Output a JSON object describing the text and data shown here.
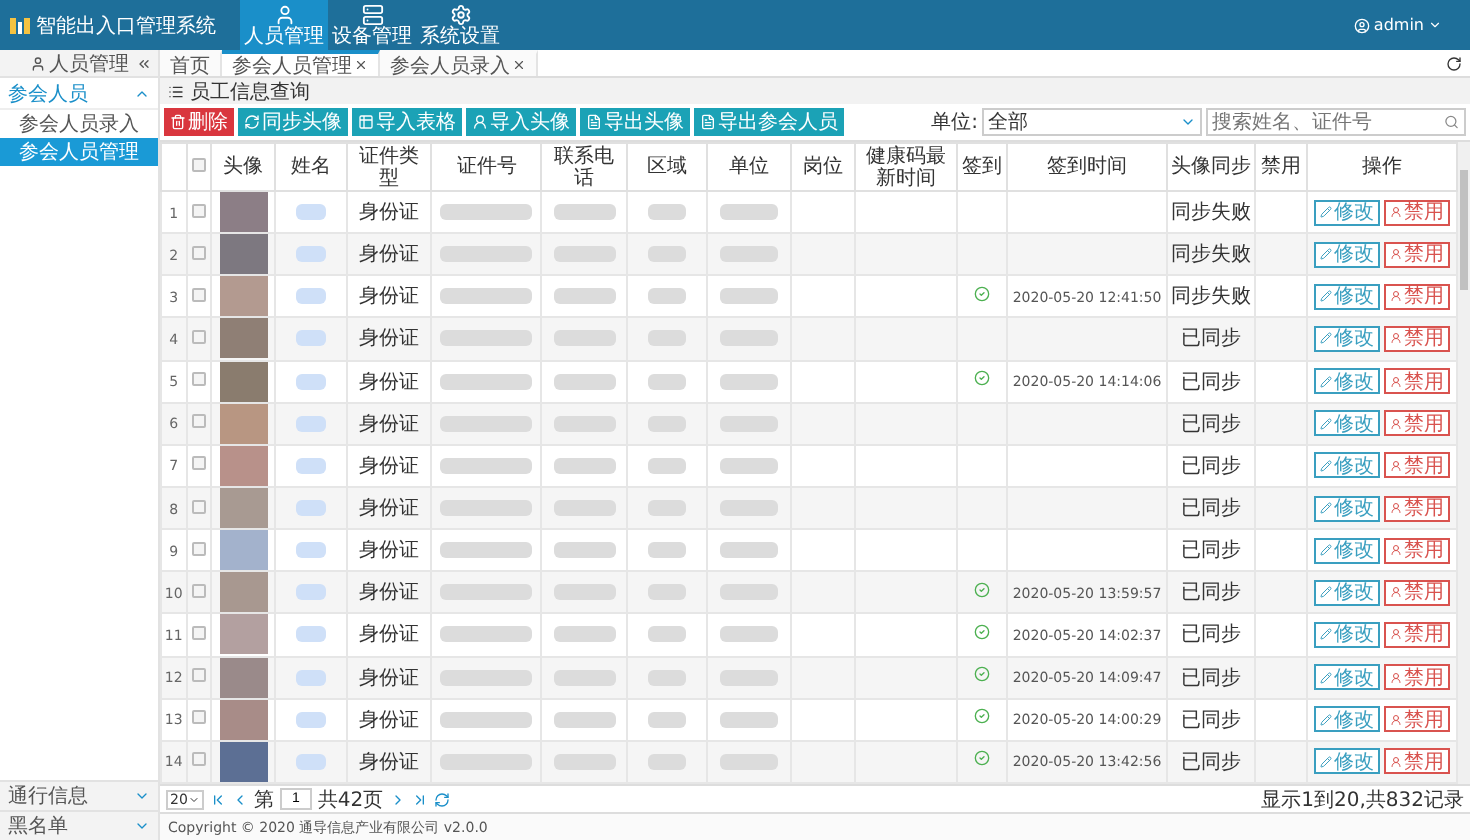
{
  "app": {
    "title": "智能出入口管理系统",
    "user": "admin"
  },
  "nav": [
    {
      "label": "人员管理",
      "selected": true
    },
    {
      "label": "设备管理",
      "selected": false
    },
    {
      "label": "系统设置",
      "selected": false
    }
  ],
  "sidebar": {
    "title": "人员管理",
    "groups": [
      {
        "label": "参会人员",
        "expanded": true,
        "items": [
          {
            "label": "参会人员录入",
            "selected": false
          },
          {
            "label": "参会人员管理",
            "selected": true
          }
        ]
      }
    ],
    "bottom": [
      {
        "label": "通行信息"
      },
      {
        "label": "黑名单"
      }
    ]
  },
  "tabs": [
    {
      "label": "首页",
      "closable": false,
      "selected": false
    },
    {
      "label": "参会人员管理",
      "closable": true,
      "selected": true
    },
    {
      "label": "参会人员录入",
      "closable": true,
      "selected": false
    }
  ],
  "panel_title": "员工信息查询",
  "toolbar": [
    {
      "label": "删除",
      "kind": "danger"
    },
    {
      "label": "同步头像",
      "kind": "normal"
    },
    {
      "label": "导入表格",
      "kind": "normal"
    },
    {
      "label": "导入头像",
      "kind": "normal"
    },
    {
      "label": "导出头像",
      "kind": "normal"
    },
    {
      "label": "导出参会人员",
      "kind": "normal"
    }
  ],
  "filter": {
    "label": "单位:",
    "value": "全部",
    "search_placeholder": "搜索姓名、证件号"
  },
  "table": {
    "select_all_checked": false,
    "columns": [
      "头像",
      "姓名",
      "证件类型",
      "证件号",
      "联系电话",
      "区域",
      "单位",
      "岗位",
      "健康码最新时间",
      "签到",
      "签到时间",
      "头像同步",
      "禁用",
      "操作"
    ],
    "rows": [
      {
        "no": "1",
        "checked": false,
        "id_type": "身份证",
        "signed": false,
        "sync": "同步失败",
        "edit": "修改",
        "disable": "禁用"
      },
      {
        "no": "2",
        "checked": false,
        "id_type": "身份证",
        "signed": false,
        "sync": "同步失败",
        "edit": "修改",
        "disable": "禁用"
      },
      {
        "no": "3",
        "checked": false,
        "id_type": "身份证",
        "signed": true,
        "sign_time": "2020-05-20 12:41:50",
        "sync": "同步失败",
        "edit": "修改",
        "disable": "禁用"
      },
      {
        "no": "4",
        "checked": false,
        "id_type": "身份证",
        "signed": false,
        "sync": "已同步",
        "edit": "修改",
        "disable": "禁用"
      },
      {
        "no": "5",
        "checked": false,
        "id_type": "身份证",
        "signed": true,
        "sign_time": "2020-05-20 14:14:06",
        "sync": "已同步",
        "edit": "修改",
        "disable": "禁用"
      },
      {
        "no": "6",
        "checked": false,
        "id_type": "身份证",
        "signed": false,
        "sync": "已同步",
        "edit": "修改",
        "disable": "禁用"
      },
      {
        "no": "7",
        "checked": false,
        "id_type": "身份证",
        "signed": false,
        "sync": "已同步",
        "edit": "修改",
        "disable": "禁用"
      },
      {
        "no": "8",
        "checked": false,
        "id_type": "身份证",
        "signed": false,
        "sync": "已同步",
        "edit": "修改",
        "disable": "禁用"
      },
      {
        "no": "9",
        "checked": false,
        "id_type": "身份证",
        "signed": false,
        "sync": "已同步",
        "edit": "修改",
        "disable": "禁用"
      },
      {
        "no": "10",
        "checked": false,
        "id_type": "身份证",
        "signed": true,
        "sign_time": "2020-05-20 13:59:57",
        "sync": "已同步",
        "edit": "修改",
        "disable": "禁用"
      },
      {
        "no": "11",
        "checked": false,
        "id_type": "身份证",
        "signed": true,
        "sign_time": "2020-05-20 14:02:37",
        "sync": "已同步",
        "edit": "修改",
        "disable": "禁用"
      },
      {
        "no": "12",
        "checked": false,
        "id_type": "身份证",
        "signed": true,
        "sign_time": "2020-05-20 14:09:47",
        "sync": "已同步",
        "edit": "修改",
        "disable": "禁用"
      },
      {
        "no": "13",
        "checked": false,
        "id_type": "身份证",
        "signed": true,
        "sign_time": "2020-05-20 14:00:29",
        "sync": "已同步",
        "edit": "修改",
        "disable": "禁用"
      },
      {
        "no": "14",
        "checked": false,
        "id_type": "身份证",
        "signed": true,
        "sign_time": "2020-05-20 13:42:56",
        "sync": "已同步",
        "edit": "修改",
        "disable": "禁用"
      }
    ]
  },
  "pager": {
    "page_size": "20",
    "page_prefix": "第",
    "page": "1",
    "page_total": "共42页",
    "summary": "显示1到20,共832记录"
  },
  "footer": "Copyright © 2020 通导信息产业有限公司 v2.0.0"
}
